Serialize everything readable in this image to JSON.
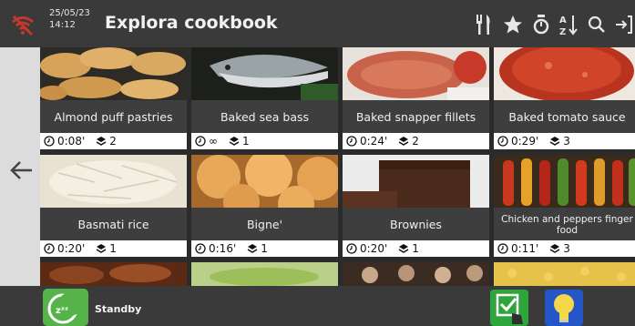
{
  "header": {
    "date": "25/05/23",
    "time": "14:12",
    "title": "Explora cookbook",
    "icons": [
      "wifi-off-icon",
      "cutlery-icon",
      "star-icon",
      "timer-icon",
      "sort-az-icon",
      "search-icon",
      "exit-icon"
    ]
  },
  "recipes": [
    {
      "name": "Almond puff pastries",
      "time": "0:08'",
      "layers": "2"
    },
    {
      "name": "Baked sea bass",
      "time": "∞",
      "layers": "1"
    },
    {
      "name": "Baked snapper fillets",
      "time": "0:24'",
      "layers": "2"
    },
    {
      "name": "Baked tomato sauce",
      "time": "0:29'",
      "layers": "3"
    },
    {
      "name": "Basmati rice",
      "time": "0:20'",
      "layers": "1"
    },
    {
      "name": "Bigne'",
      "time": "0:16'",
      "layers": "1"
    },
    {
      "name": "Brownies",
      "time": "0:20'",
      "layers": "1"
    },
    {
      "name": "Chicken and peppers finger food",
      "time": "0:11'",
      "layers": "3"
    }
  ],
  "footer": {
    "standby_label": "Standby",
    "standby_icon_text": "zᶻᶻ"
  },
  "colors": {
    "header_bg": "#3a3a3a",
    "sidebar_bg": "#dcdcdc",
    "standby_green": "#56b34a",
    "ok_green": "#2fa63c",
    "bulb_blue": "#2456c8"
  }
}
